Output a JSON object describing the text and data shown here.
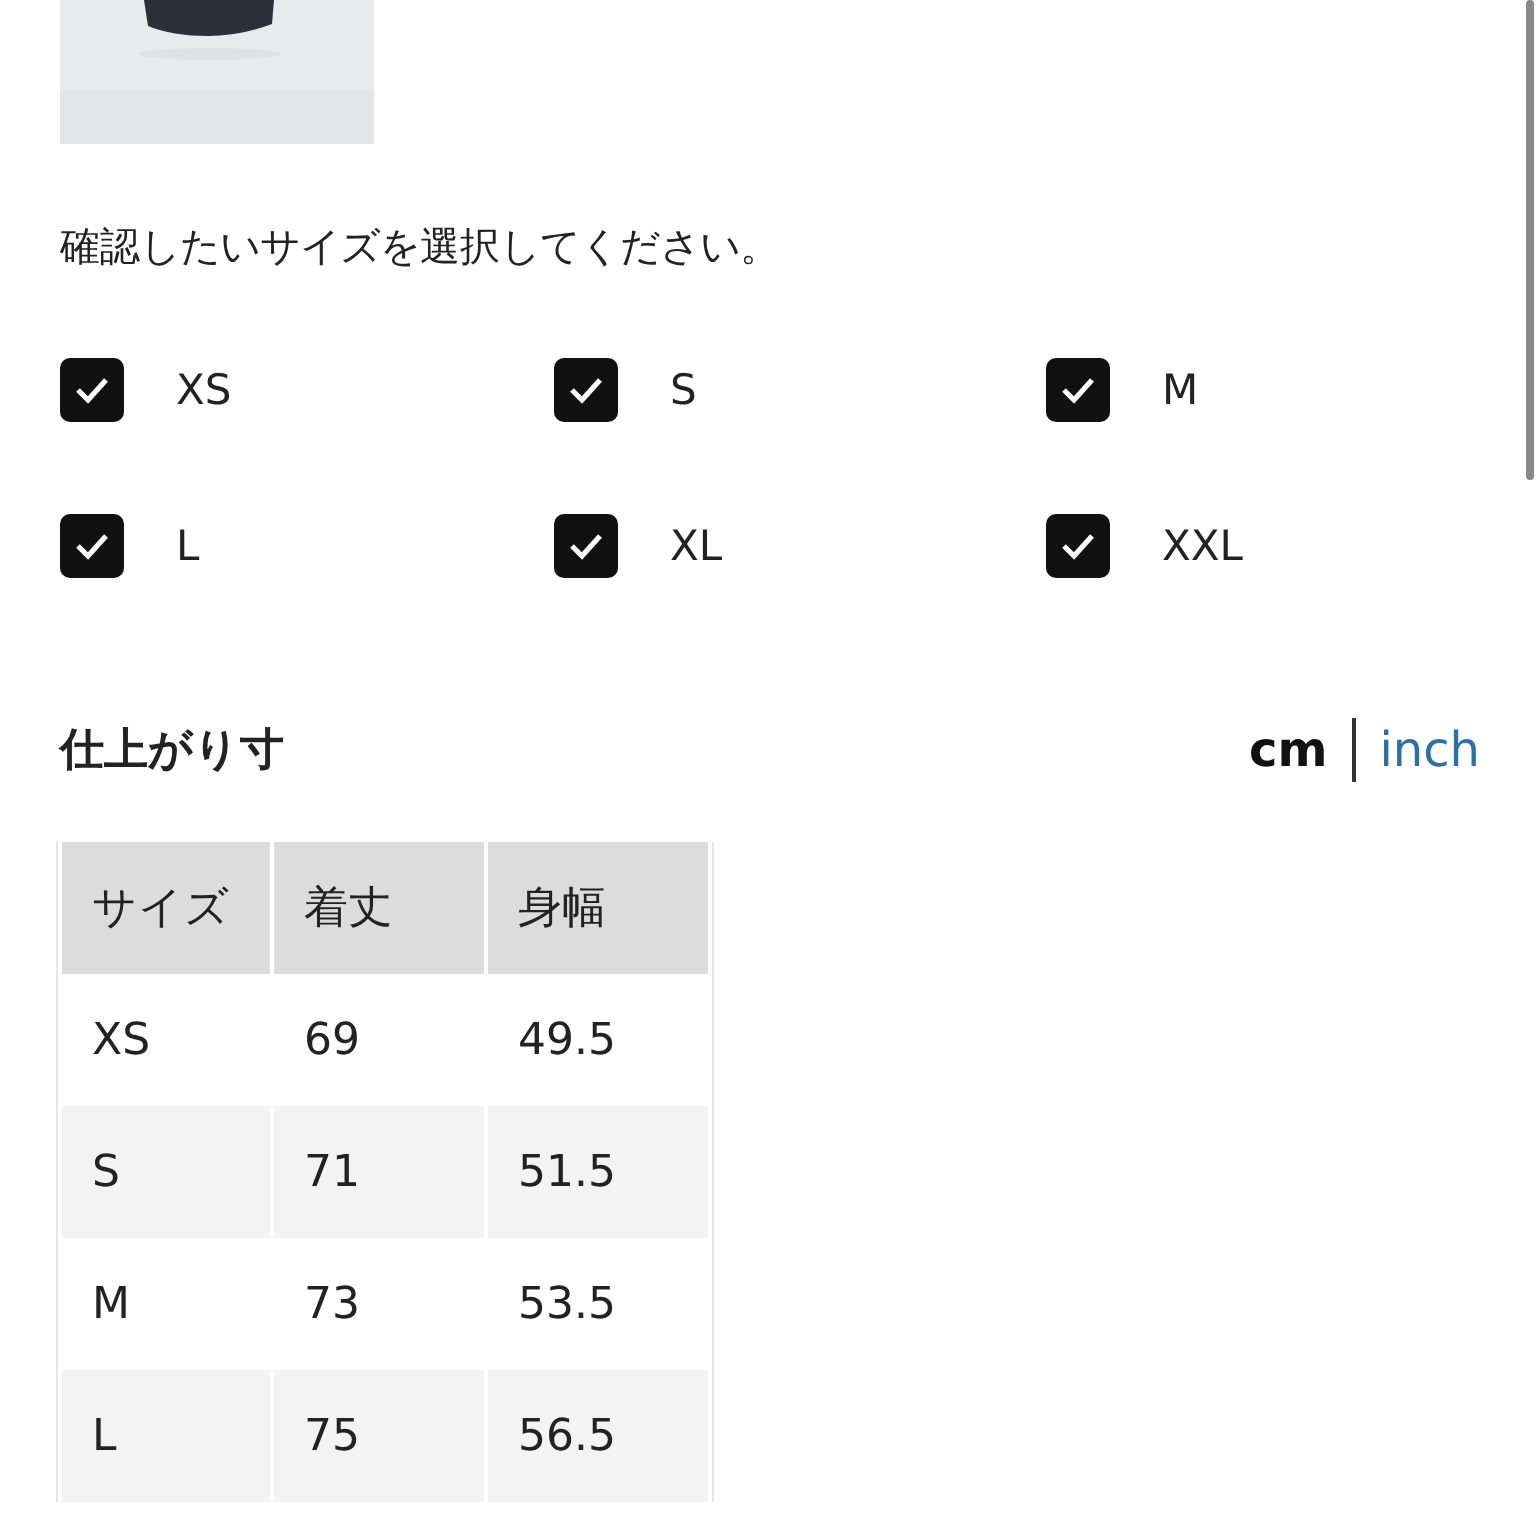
{
  "prompt": "確認したいサイズを選択してください。",
  "size_filters": [
    {
      "label": "XS",
      "checked": true
    },
    {
      "label": "S",
      "checked": true
    },
    {
      "label": "M",
      "checked": true
    },
    {
      "label": "L",
      "checked": true
    },
    {
      "label": "XL",
      "checked": true
    },
    {
      "label": "XXL",
      "checked": true
    }
  ],
  "section_title": "仕上がり寸",
  "units": [
    {
      "label": "cm",
      "selected": true
    },
    {
      "label": "inch",
      "selected": false
    }
  ],
  "table": {
    "columns": [
      "サイズ",
      "着丈",
      "身幅"
    ],
    "rows": [
      [
        "XS",
        "69",
        "49.5"
      ],
      [
        "S",
        "71",
        "51.5"
      ],
      [
        "M",
        "73",
        "53.5"
      ],
      [
        "L",
        "75",
        "56.5"
      ]
    ]
  }
}
